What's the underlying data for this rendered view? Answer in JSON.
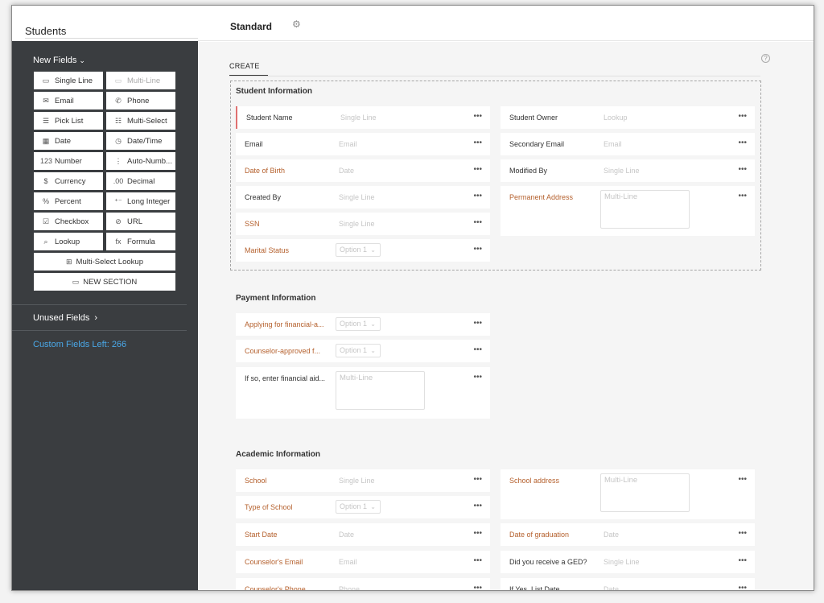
{
  "module_title": "Students",
  "layout": {
    "name": "Standard"
  },
  "sidebar": {
    "new_fields_label": "New Fields",
    "palette": [
      {
        "label": "Single Line",
        "icon": "▭",
        "disabled": false
      },
      {
        "label": "Multi-Line",
        "icon": "▭",
        "disabled": true
      },
      {
        "label": "Email",
        "icon": "✉",
        "disabled": false
      },
      {
        "label": "Phone",
        "icon": "✆",
        "disabled": false
      },
      {
        "label": "Pick List",
        "icon": "☰",
        "disabled": false
      },
      {
        "label": "Multi-Select",
        "icon": "☷",
        "disabled": false
      },
      {
        "label": "Date",
        "icon": "▦",
        "disabled": false
      },
      {
        "label": "Date/Time",
        "icon": "◷",
        "disabled": false
      },
      {
        "label": "Number",
        "icon": "123",
        "disabled": false
      },
      {
        "label": "Auto-Numb...",
        "icon": "⋮",
        "disabled": false
      },
      {
        "label": "Currency",
        "icon": "$",
        "disabled": false
      },
      {
        "label": "Decimal",
        "icon": ".00",
        "disabled": false
      },
      {
        "label": "Percent",
        "icon": "%",
        "disabled": false
      },
      {
        "label": "Long Integer",
        "icon": "⁺⁻",
        "disabled": false
      },
      {
        "label": "Checkbox",
        "icon": "☑",
        "disabled": false
      },
      {
        "label": "URL",
        "icon": "⊘",
        "disabled": false
      },
      {
        "label": "Lookup",
        "icon": "⌕",
        "disabled": false
      },
      {
        "label": "Formula",
        "icon": "fx",
        "disabled": false
      }
    ],
    "multi_select_lookup": "Multi-Select Lookup",
    "new_section": "NEW SECTION",
    "unused_fields_label": "Unused Fields",
    "custom_fields_left": "Custom Fields Left: 266"
  },
  "tabs": {
    "create": "CREATE"
  },
  "sections": {
    "student": {
      "title": "Student Information",
      "left": [
        {
          "label": "Student Name",
          "placeholder": "Single Line",
          "required": false,
          "kind": "text"
        },
        {
          "label": "Email",
          "placeholder": "Email",
          "required": false,
          "kind": "text"
        },
        {
          "label": "Date of Birth",
          "placeholder": "Date",
          "required": true,
          "kind": "text"
        },
        {
          "label": "Created By",
          "placeholder": "Single Line",
          "required": false,
          "kind": "text"
        },
        {
          "label": "SSN",
          "placeholder": "Single Line",
          "required": true,
          "kind": "text"
        },
        {
          "label": "Marital Status",
          "placeholder": "Option 1",
          "required": true,
          "kind": "select"
        }
      ],
      "right": [
        {
          "label": "Student Owner",
          "placeholder": "Lookup",
          "required": false,
          "kind": "text"
        },
        {
          "label": "Secondary Email",
          "placeholder": "Email",
          "required": false,
          "kind": "text"
        },
        {
          "label": "Modified By",
          "placeholder": "Single Line",
          "required": false,
          "kind": "text"
        },
        {
          "label": "Permanent Address",
          "placeholder": "Multi-Line",
          "required": true,
          "kind": "textarea"
        }
      ]
    },
    "payment": {
      "title": "Payment Information",
      "left": [
        {
          "label": "Applying for financial-a...",
          "placeholder": "Option 1",
          "required": true,
          "kind": "select"
        },
        {
          "label": "Counselor-approved f...",
          "placeholder": "Option 1",
          "required": true,
          "kind": "select"
        },
        {
          "label": "If so, enter financial aid...",
          "placeholder": "Multi-Line",
          "required": false,
          "kind": "textarea"
        }
      ]
    },
    "academic": {
      "title": "Academic Information",
      "left": [
        {
          "label": "School",
          "placeholder": "Single Line",
          "required": true,
          "kind": "text"
        },
        {
          "label": "Type of School",
          "placeholder": "Option 1",
          "required": true,
          "kind": "select"
        },
        {
          "label": "Start Date",
          "placeholder": "Date",
          "required": true,
          "kind": "text"
        },
        {
          "label": "Counselor's Email",
          "placeholder": "Email",
          "required": true,
          "kind": "text"
        },
        {
          "label": "Counselor's Phone",
          "placeholder": "Phone",
          "required": true,
          "kind": "text"
        }
      ],
      "right": [
        {
          "label": "School address",
          "placeholder": "Multi-Line",
          "required": true,
          "kind": "textarea"
        },
        {
          "label": "Date of graduation",
          "placeholder": "Date",
          "required": true,
          "kind": "text"
        },
        {
          "label": "Did you receive a GED?",
          "placeholder": "Single Line",
          "required": false,
          "kind": "text"
        },
        {
          "label": "If Yes, List Date",
          "placeholder": "Date",
          "required": false,
          "kind": "text"
        }
      ]
    }
  },
  "more_glyph": "•••",
  "caret_glyph": "⌄",
  "icons": {
    "gear": "⚙",
    "help": "?",
    "chevron_down": "⌄",
    "chevron_right": "›",
    "section": "▭",
    "msl": "⊞"
  }
}
